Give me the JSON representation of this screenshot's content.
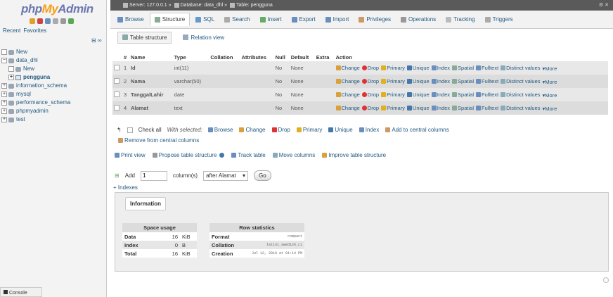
{
  "nav": {
    "logo_php": "php",
    "logo_my": "My",
    "logo_admin": "Admin",
    "recent": "Recent",
    "favorites": "Favorites",
    "tree": [
      {
        "label": "New",
        "level": 0,
        "kind": "new"
      },
      {
        "label": "data_dhl",
        "level": 0,
        "kind": "db"
      },
      {
        "label": "New",
        "level": 1,
        "kind": "new"
      },
      {
        "label": "pengguna",
        "level": 1,
        "kind": "table",
        "active": true
      },
      {
        "label": "information_schema",
        "level": 0,
        "kind": "db"
      },
      {
        "label": "mysql",
        "level": 0,
        "kind": "db"
      },
      {
        "label": "performance_schema",
        "level": 0,
        "kind": "db"
      },
      {
        "label": "phpmyadmin",
        "level": 0,
        "kind": "db"
      },
      {
        "label": "test",
        "level": 0,
        "kind": "db"
      }
    ]
  },
  "breadcrumb": {
    "server": "Server: 127.0.0.1",
    "database": "Database: data_dhl",
    "table": "Table: pengguna"
  },
  "tabs": [
    "Browse",
    "Structure",
    "SQL",
    "Search",
    "Insert",
    "Export",
    "Import",
    "Privileges",
    "Operations",
    "Tracking",
    "Triggers"
  ],
  "subtabs": [
    "Table structure",
    "Relation view"
  ],
  "structure": {
    "headers": [
      "#",
      "Name",
      "Type",
      "Collation",
      "Attributes",
      "Null",
      "Default",
      "Extra",
      "Action"
    ],
    "rows": [
      {
        "num": "1",
        "name": "Id",
        "type": "int(11)",
        "collation": "",
        "attributes": "",
        "null": "No",
        "default": "None",
        "extra": ""
      },
      {
        "num": "2",
        "name": "Nama",
        "type": "varchar(50)",
        "collation": "",
        "attributes": "",
        "null": "No",
        "default": "None",
        "extra": ""
      },
      {
        "num": "3",
        "name": "TanggalLahir",
        "type": "date",
        "collation": "",
        "attributes": "",
        "null": "No",
        "default": "None",
        "extra": ""
      },
      {
        "num": "4",
        "name": "Alamat",
        "type": "text",
        "collation": "",
        "attributes": "",
        "null": "No",
        "default": "None",
        "extra": ""
      }
    ],
    "actions": [
      "Change",
      "Drop",
      "Primary",
      "Unique",
      "Index",
      "Spatial",
      "Fulltext",
      "Distinct values"
    ],
    "more": "More"
  },
  "with_selected": {
    "check_all": "Check all",
    "label": "With selected:",
    "options": [
      "Browse",
      "Change",
      "Drop",
      "Primary",
      "Unique",
      "Index",
      "Add to central columns"
    ],
    "remove": "Remove from central columns"
  },
  "links": [
    "Print view",
    "Propose table structure",
    "Track table",
    "Move columns",
    "Improve table structure"
  ],
  "add": {
    "label": "Add",
    "value": "1",
    "columns": "column(s)",
    "position": "after Alamat",
    "go": "Go"
  },
  "indexes": "+ Indexes",
  "information": {
    "legend": "Information",
    "space_title": "Space usage",
    "space": [
      {
        "label": "Data",
        "value": "16",
        "unit": "KiB"
      },
      {
        "label": "Index",
        "value": "0",
        "unit": "B"
      },
      {
        "label": "Total",
        "value": "16",
        "unit": "KiB"
      }
    ],
    "row_title": "Row statistics",
    "rows": [
      {
        "label": "Format",
        "value": "compact"
      },
      {
        "label": "Collation",
        "value": "latin1_swedish_ci"
      },
      {
        "label": "Creation",
        "value": "Jul 12, 2018 at 01:14 PM"
      }
    ]
  },
  "console": "Console"
}
